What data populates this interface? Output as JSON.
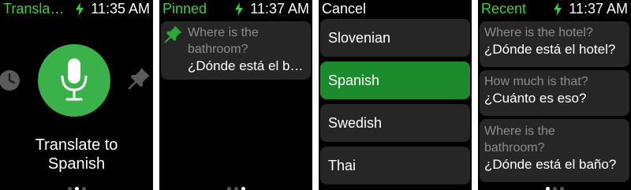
{
  "screens": [
    {
      "title": "Transla…",
      "time": "11:35 AM",
      "main_action_line1": "Translate to",
      "main_action_line2": "Spanish",
      "icons": {
        "left": "clock-icon",
        "center": "microphone-icon",
        "right": "pin-icon"
      },
      "page_indicator": {
        "count": 3,
        "active": 2
      }
    },
    {
      "title": "Pinned",
      "time": "11:37 AM",
      "items": [
        {
          "question": "Where is the",
          "question2": "bathroom?",
          "answer": "¿Dónde está el baño?"
        }
      ],
      "page_indicator": {
        "count": 3,
        "active": 3
      }
    },
    {
      "title": "Cancel",
      "languages": [
        "Slovenian",
        "Spanish",
        "Swedish",
        "Thai"
      ],
      "selected_language": "Spanish"
    },
    {
      "title": "Recent",
      "time": "11:37 AM",
      "items": [
        {
          "question": "Where is the hotel?",
          "answer": "¿Dónde está el hotel?"
        },
        {
          "question": "How much is that?",
          "answer": "¿Cuánto es eso?"
        },
        {
          "question": "Where is the",
          "question2": "bathroom?",
          "answer": "¿Dónde está el baño?"
        }
      ],
      "page_indicator": {
        "count": 3,
        "active": 1
      }
    }
  ],
  "colors": {
    "accent_green": "#38d13b",
    "mic_green": "#3bb14a",
    "selected_green": "#1c8b2c",
    "card": "#262626"
  }
}
